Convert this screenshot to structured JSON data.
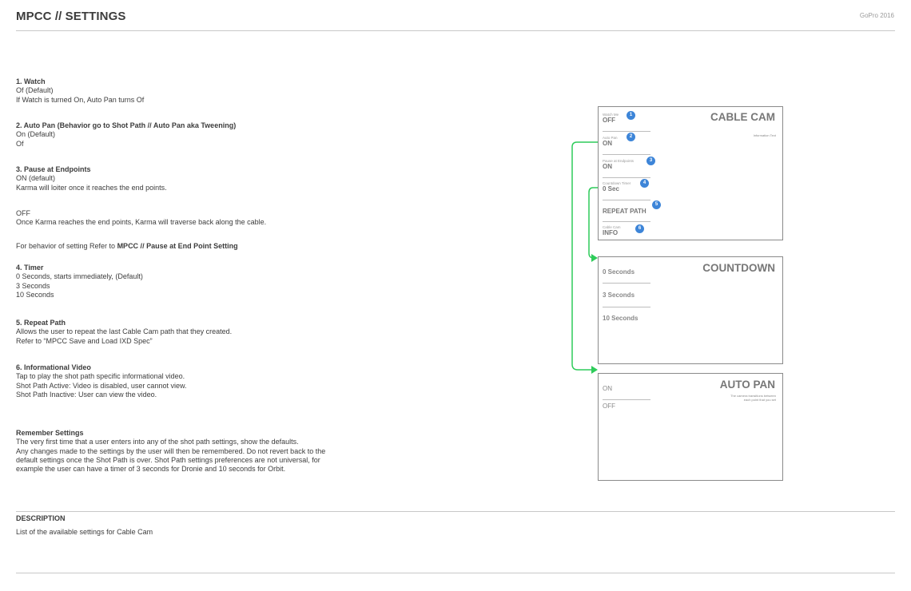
{
  "header": {
    "title": "MPCC // SETTINGS",
    "brand": "GoPro 2016"
  },
  "spec": {
    "watch": {
      "heading": "1. Watch",
      "lines": [
        "Of  (Default)",
        "If Watch is turned On, Auto Pan turns Of"
      ]
    },
    "auto_pan": {
      "heading": "2. Auto Pan (Behavior go to Shot Path // Auto Pan aka Tweening)",
      "lines": [
        "On (Default)",
        "Of"
      ]
    },
    "pause": {
      "heading": "3. Pause at Endpoints",
      "lines": [
        "ON (default)",
        "Karma will loiter once it reaches the end points."
      ],
      "off_lines": [
        "OFF",
        "Once Karma reaches the end points, Karma will traverse back along the cable."
      ],
      "refer_prefix": "For behavior of setting Refer to ",
      "refer_bold": "MPCC // Pause at End Point Setting"
    },
    "timer": {
      "heading": "4. Timer",
      "lines": [
        "0 Seconds, starts immediately, (Default)",
        "3 Seconds",
        "10 Seconds"
      ]
    },
    "repeat": {
      "heading": "5. Repeat Path",
      "lines": [
        "Allows the user to repeat the last Cable Cam path that they created.",
        "Refer to “MPCC Save and Load IXD Spec”"
      ]
    },
    "video": {
      "heading": "6. Informational Video",
      "lines": [
        "Tap to play the shot path specific informational video.",
        "Shot Path Active: Video is disabled, user cannot view.",
        "Shot Path Inactive: User can view the video."
      ]
    },
    "remember": {
      "heading": "Remember Settings",
      "lines": [
        "The very first time that a user enters into any of the shot path settings, show the defaults.",
        "Any changes made to the settings by the user will then be remembered. Do not revert back to the",
        "default settings once the Shot Path is over. Shot Path settings preferences are not universal, for",
        "example the user can have a timer of 3 seconds for Dronie and 10 seconds for Orbit."
      ]
    }
  },
  "description": {
    "title": "DESCRIPTION",
    "body": "List of the available settings for Cable Cam"
  },
  "cable_cam": {
    "title": "CABLE CAM",
    "info_text": "Information Text",
    "rows": [
      {
        "label": "Watch Me",
        "value": "OFF",
        "badge": "1"
      },
      {
        "label": "Auto Pan",
        "value": "ON",
        "badge": "2"
      },
      {
        "label": "Pause at Endpoints",
        "value": "ON",
        "badge": "3"
      },
      {
        "label": "Countdown Timer",
        "value": "0 Sec",
        "badge": "4"
      },
      {
        "label": "",
        "value": "REPEAT PATH",
        "badge": "5"
      },
      {
        "label": "Cable Cam",
        "value": "INFO",
        "badge": "6"
      }
    ]
  },
  "countdown": {
    "title": "COUNTDOWN",
    "options": [
      "0 Seconds",
      "3 Seconds",
      "10 Seconds"
    ]
  },
  "auto_pan_panel": {
    "title": "AUTO PAN",
    "subtitle_lines": [
      "The camera transitions between",
      "each point that you set"
    ],
    "options": [
      "ON",
      "OFF"
    ]
  },
  "colors": {
    "connector": "#2ecc5a",
    "badge": "#3d85d8",
    "panel_border": "#8a8a8a"
  }
}
